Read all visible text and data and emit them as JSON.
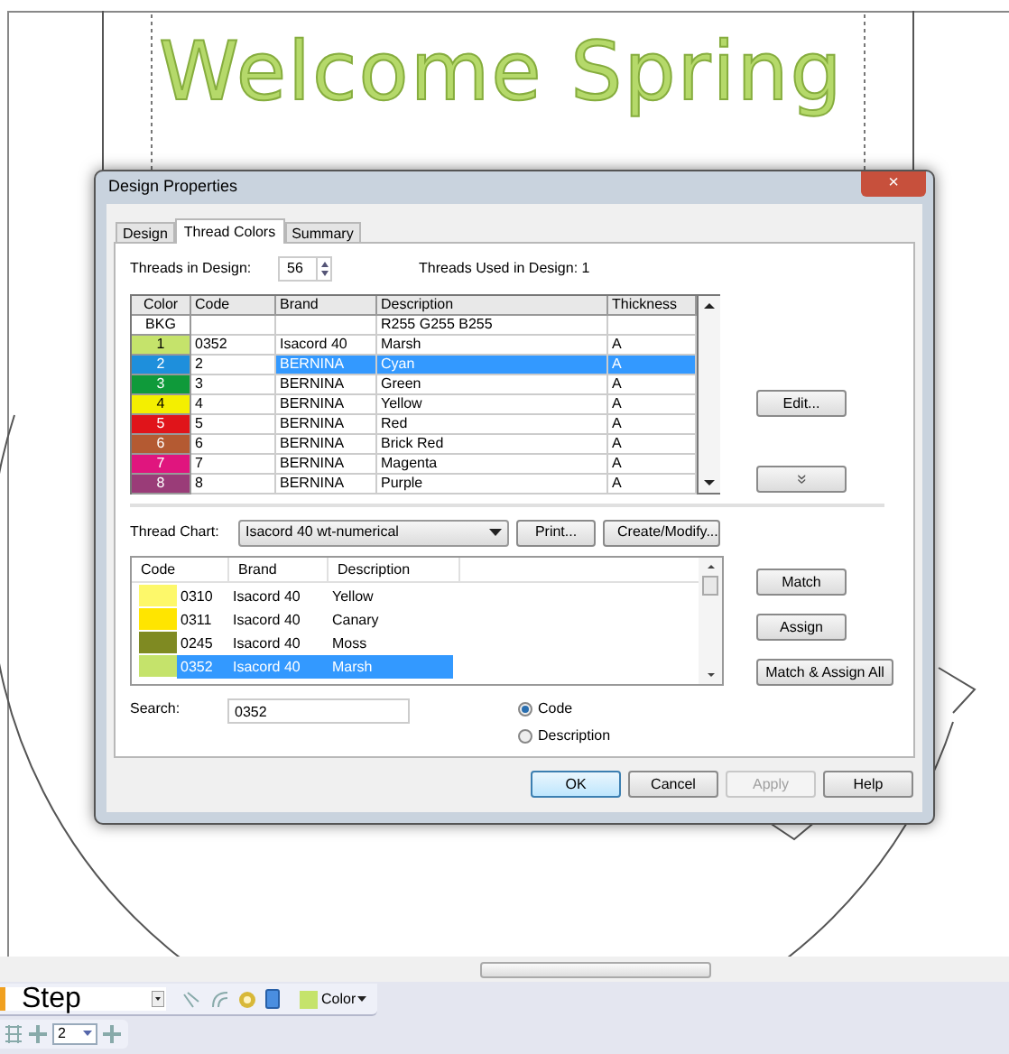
{
  "canvas": {
    "design_text": "Welcome Spring"
  },
  "dialog": {
    "title": "Design Properties",
    "close": "×",
    "tabs": [
      {
        "label": "Design",
        "selected": false
      },
      {
        "label": "Thread Colors",
        "selected": true
      },
      {
        "label": "Summary",
        "selected": false
      }
    ],
    "threads_in_design": {
      "label": "Threads in Design:",
      "value": "56"
    },
    "threads_used": "Threads Used in Design: 1",
    "design_table": {
      "columns": [
        "Color",
        "Code",
        "Brand",
        "Description",
        "Thickness"
      ],
      "rows": [
        {
          "color_label": "BKG",
          "color": "#ffffff",
          "code": "",
          "brand": "",
          "description": "R255 G255 B255",
          "thickness": "",
          "selected": false
        },
        {
          "color_label": "1",
          "color": "#c5e36b",
          "code": "0352",
          "brand": "Isacord 40",
          "description": "Marsh",
          "thickness": "A",
          "selected": false
        },
        {
          "color_label": "2",
          "color": "#1e8fdc",
          "code": "2",
          "brand": "BERNINA",
          "description": "Cyan",
          "thickness": "A",
          "selected": true
        },
        {
          "color_label": "3",
          "color": "#0f9a3a",
          "code": "3",
          "brand": "BERNINA",
          "description": "Green",
          "thickness": "A",
          "selected": false
        },
        {
          "color_label": "4",
          "color": "#f4ef00",
          "code": "4",
          "brand": "BERNINA",
          "description": "Yellow",
          "thickness": "A",
          "selected": false
        },
        {
          "color_label": "5",
          "color": "#e0141a",
          "code": "5",
          "brand": "BERNINA",
          "description": "Red",
          "thickness": "A",
          "selected": false
        },
        {
          "color_label": "6",
          "color": "#b45a32",
          "code": "6",
          "brand": "BERNINA",
          "description": "Brick Red",
          "thickness": "A",
          "selected": false
        },
        {
          "color_label": "7",
          "color": "#e0157e",
          "code": "7",
          "brand": "BERNINA",
          "description": "Magenta",
          "thickness": "A",
          "selected": false
        },
        {
          "color_label": "8",
          "color": "#9a3c78",
          "code": "8",
          "brand": "BERNINA",
          "description": "Purple",
          "thickness": "A",
          "selected": false
        }
      ]
    },
    "table_buttons": [
      {
        "kind": "text",
        "label": "Edit..."
      },
      {
        "kind": "chevron",
        "label": "»"
      }
    ],
    "thread_chart": {
      "label": "Thread Chart:",
      "value": "Isacord 40 wt-numerical",
      "buttons": [
        "Print...",
        "Create/Modify..."
      ]
    },
    "chart_table": {
      "columns": [
        "Code",
        "Brand",
        "Description"
      ],
      "rows": [
        {
          "color": "#fdf86a",
          "code": "0310",
          "brand": "Isacord 40",
          "description": "Yellow",
          "selected": false
        },
        {
          "color": "#ffe500",
          "code": "0311",
          "brand": "Isacord 40",
          "description": "Canary",
          "selected": false
        },
        {
          "color": "#7f8a22",
          "code": "0245",
          "brand": "Isacord 40",
          "description": "Moss",
          "selected": false
        },
        {
          "color": "#c5e36b",
          "code": "0352",
          "brand": "Isacord 40",
          "description": "Marsh",
          "selected": true
        }
      ]
    },
    "chart_buttons": [
      "Match",
      "Assign",
      "Match & Assign All"
    ],
    "search": {
      "label": "Search:",
      "value": "0352"
    },
    "search_by": [
      {
        "label": "Code",
        "selected": true
      },
      {
        "label": "Description",
        "selected": false
      }
    ],
    "footer_buttons": [
      {
        "label": "OK",
        "disabled": false
      },
      {
        "label": "Cancel",
        "disabled": false
      },
      {
        "label": "Apply",
        "disabled": true
      },
      {
        "label": "Help",
        "disabled": false
      }
    ]
  },
  "toolbar": {
    "step": "Step",
    "color_button": "Color",
    "spin_value": "2"
  }
}
